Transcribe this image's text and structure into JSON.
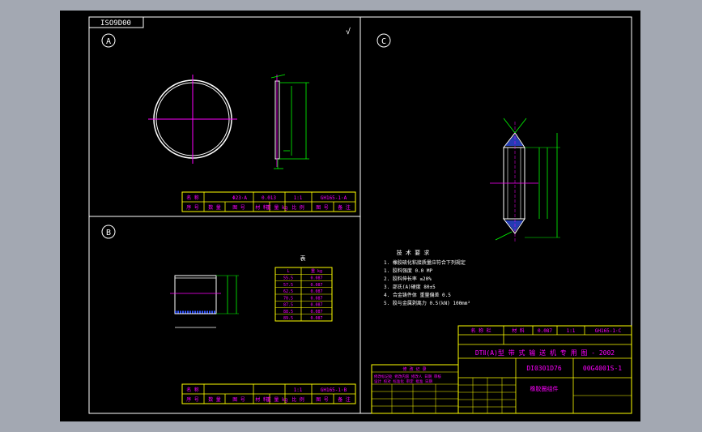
{
  "colors": {
    "background": "#a3a8b2",
    "sheet": "#000000",
    "border": "#ffffff",
    "table": "#ffff00",
    "text": "#ff00ff",
    "dimension": "#00ff00",
    "hatch": "#3355ff"
  },
  "sheet": {
    "drawing_number_box": "ISO9D00"
  },
  "views": {
    "a": {
      "label": "A",
      "check_mark": "√",
      "title_block": {
        "row1": [
          "名 称",
          "Φ23·A",
          "0.013",
          "1:1",
          "GH165-1·A"
        ],
        "row2": [
          "序 号",
          "数 量",
          "图 号",
          "材 料",
          "重 量 kg",
          "比 例",
          "图 号",
          "备 注"
        ]
      }
    },
    "b": {
      "label": "B",
      "table_title": "表",
      "table_header": [
        "L",
        "重 kg"
      ],
      "table_rows": [
        [
          "55.5",
          "0.087"
        ],
        [
          "57.5",
          "0.087"
        ],
        [
          "62.5",
          "0.087"
        ],
        [
          "70.5",
          "0.087"
        ],
        [
          "87.5",
          "0.087"
        ],
        [
          "88.5",
          "0.087"
        ],
        [
          "89.5",
          "0.087"
        ]
      ],
      "title_block": {
        "row1": [
          "名 称",
          "",
          "",
          "1:1",
          "GH165-1·B"
        ],
        "row2": [
          "序 号",
          "数 量",
          "图 号",
          "材 料",
          "重 量 kg",
          "比 例",
          "图 号",
          "备 注"
        ]
      }
    },
    "c": {
      "label": "C",
      "tech_title": "技 术 要 求",
      "tech_lines": [
        "1. 橡胶硫化粘接质量应符合下列规定",
        "1. 胶料强度        0.0 MP",
        "2. 胶料伸长率      ≥20%",
        "3. 邵氏(A)硬度     80±5",
        "4. 合金铸件体 重量偏差 0.5",
        "5. 胶与金属剥离力 0.5(kN)  100mm²"
      ]
    }
  },
  "title_block": {
    "top_row": [
      "名 称 栏",
      "材 料",
      "0.087",
      "1:1",
      "GH165-1·C"
    ],
    "title": "DTⅡ(A)型  带 式 输 送 机 专 用 图 - 2002",
    "code_left": "DI0301D76",
    "code_right": "00G4001S-1",
    "part_name": "橡胶圈组件",
    "revision_header": "修 改 记 录",
    "revision_lines": [
      "修改标记处 修改内容 修改人 日期 审核",
      "设计 校对 标准化 审定 批准 日期"
    ]
  }
}
